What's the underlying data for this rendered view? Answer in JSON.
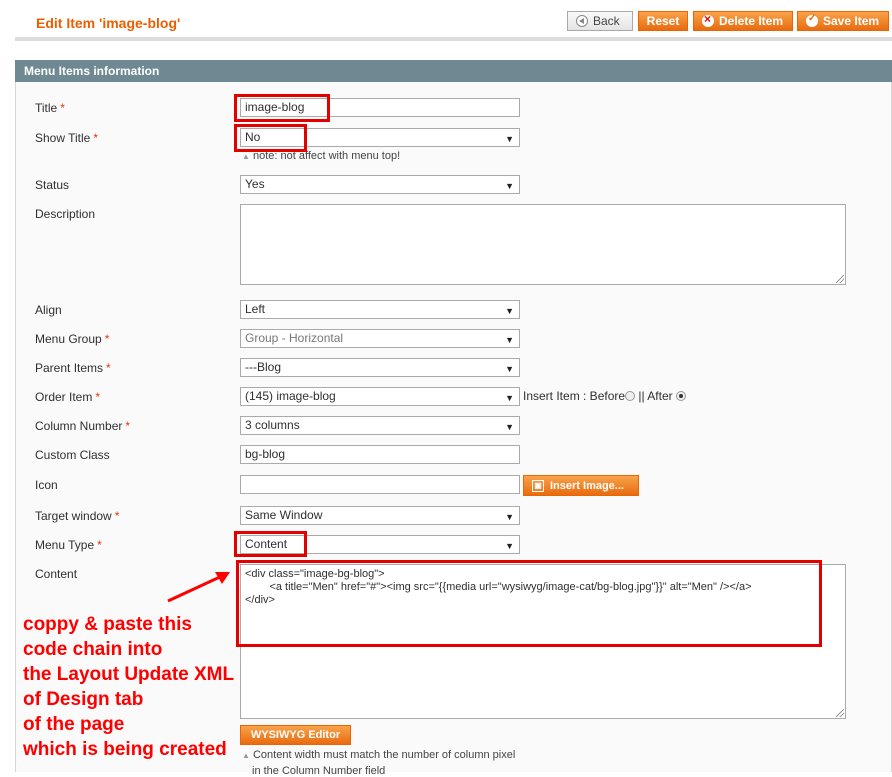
{
  "header": {
    "title": "Edit Item 'image-blog'",
    "buttons": {
      "back": "Back",
      "reset": "Reset",
      "delete": "Delete Item",
      "save": "Save Item"
    }
  },
  "section": {
    "title": "Menu Items information"
  },
  "form": {
    "title": {
      "label": "Title",
      "value": "image-blog"
    },
    "show_title": {
      "label": "Show Title",
      "value": "No",
      "note": "note: not affect with menu top!"
    },
    "status": {
      "label": "Status",
      "value": "Yes"
    },
    "description": {
      "label": "Description",
      "value": ""
    },
    "align": {
      "label": "Align",
      "value": "Left"
    },
    "menu_group": {
      "label": "Menu Group",
      "value": "Group - Horizontal"
    },
    "parent_items": {
      "label": "Parent Items",
      "value": "---Blog"
    },
    "order_item": {
      "label": "Order Item",
      "value": "(145) image-blog",
      "insert_label": "Insert Item : Before",
      "after_label": "|| After",
      "selected": "After"
    },
    "column_number": {
      "label": "Column Number",
      "value": "3 columns"
    },
    "custom_class": {
      "label": "Custom Class",
      "value": "bg-blog"
    },
    "icon": {
      "label": "Icon",
      "value": "",
      "button": "Insert Image..."
    },
    "target_window": {
      "label": "Target window",
      "value": "Same Window"
    },
    "menu_type": {
      "label": "Menu Type",
      "value": "Content"
    },
    "content": {
      "label": "Content",
      "lines": [
        "<div class=\"image-bg-blog\">",
        "        <a title=\"Men\" href=\"#\"><img src=\"{{media url=\"wysiwyg/image-cat/bg-blog.jpg\"}}\" alt=\"Men\" /></a>",
        "</div>"
      ],
      "wysiwyg_button": "WYSIWYG Editor",
      "note_line1": "Content width must match the number of column pixel",
      "note_line2": "in the Column Number field"
    },
    "required_mark": "*"
  },
  "annotation": {
    "lines": [
      "coppy & paste this",
      "code chain into",
      "the Layout Update XML",
      "of Design tab",
      "of the page",
      "which is being created"
    ],
    "color": "#ff0000"
  }
}
